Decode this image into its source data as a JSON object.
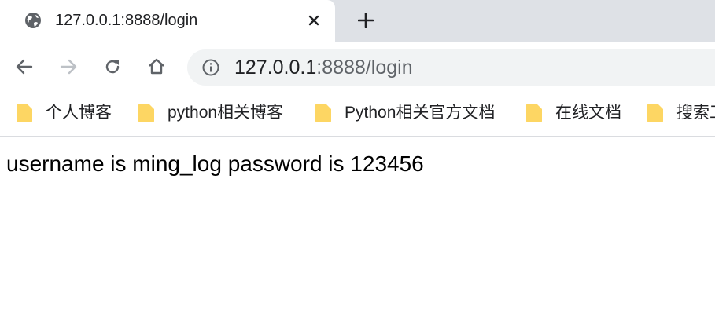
{
  "tab": {
    "title": "127.0.0.1:8888/login",
    "favicon": "globe-icon",
    "close_icon": "close-icon"
  },
  "new_tab_icon": "plus-icon",
  "toolbar": {
    "back_icon": "back-arrow-icon",
    "forward_icon": "forward-arrow-icon",
    "reload_icon": "reload-icon",
    "home_icon": "home-icon",
    "url_host": "127.0.0.1",
    "url_rest": ":8888/login",
    "info_icon": "info-icon"
  },
  "bookmarks": [
    {
      "label": "个人博客",
      "icon": "folder-icon"
    },
    {
      "label": "python相关博客",
      "icon": "folder-icon"
    },
    {
      "label": "Python相关官方文档",
      "icon": "folder-icon"
    },
    {
      "label": "在线文档",
      "icon": "folder-icon"
    },
    {
      "label": "搜索工",
      "icon": "folder-icon"
    }
  ],
  "page": {
    "body_text": "username is ming_log password is 123456"
  },
  "colors": {
    "tab_strip": "#dee1e6",
    "omnibox": "#f1f3f4",
    "folder": "#fdd663",
    "icon": "#5f6368"
  }
}
